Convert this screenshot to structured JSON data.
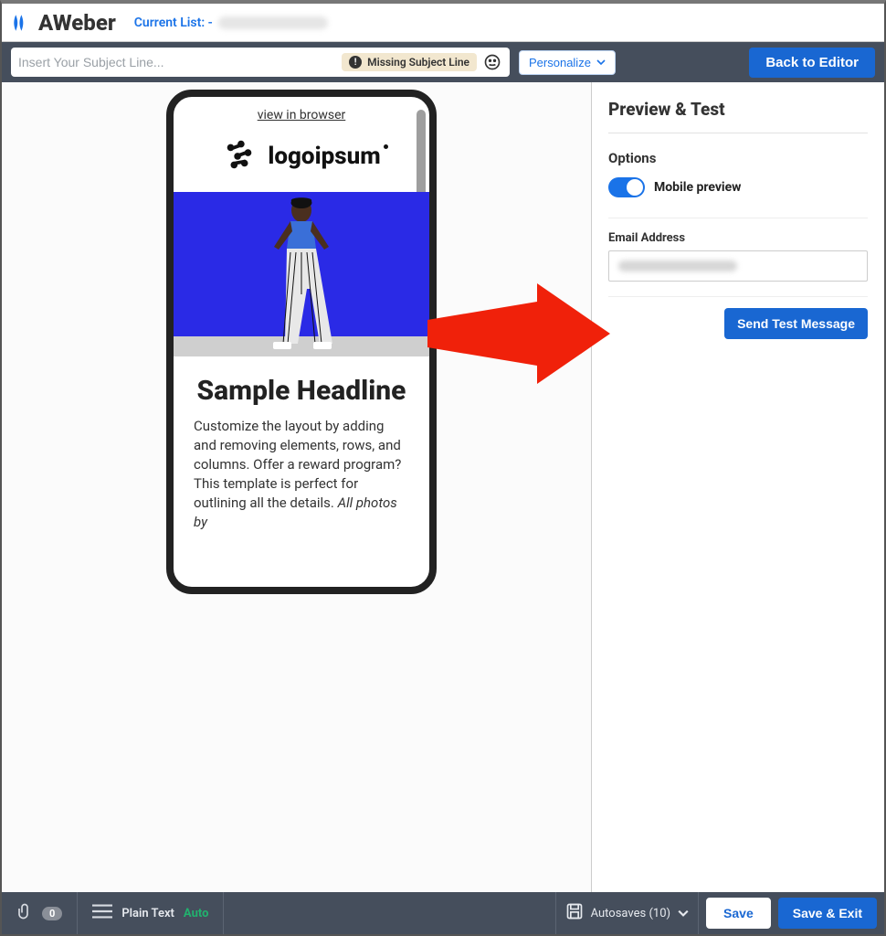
{
  "brand": {
    "name": "AWeber",
    "currentListLabel": "Current List: -"
  },
  "subjectBar": {
    "placeholder": "Insert Your Subject Line...",
    "missingBadge": "Missing Subject Line",
    "personalize": "Personalize",
    "back": "Back to Editor"
  },
  "preview": {
    "viewInBrowser": "view in browser",
    "logoWord": "logoipsum",
    "headline": "Sample Headline",
    "paragraph": "Customize the layout by adding and removing elements, rows, and columns. Offer a reward program? This template is perfect for outlining all the details. ",
    "paragraphItalic": "All photos by"
  },
  "panel": {
    "title": "Preview & Test",
    "optionsLabel": "Options",
    "toggleLabel": "Mobile preview",
    "emailLabel": "Email Address",
    "sendTest": "Send Test Message"
  },
  "footer": {
    "attachCount": "0",
    "plainText": "Plain Text",
    "auto": "Auto",
    "autosaves": "Autosaves (10)",
    "save": "Save",
    "saveExit": "Save & Exit"
  }
}
